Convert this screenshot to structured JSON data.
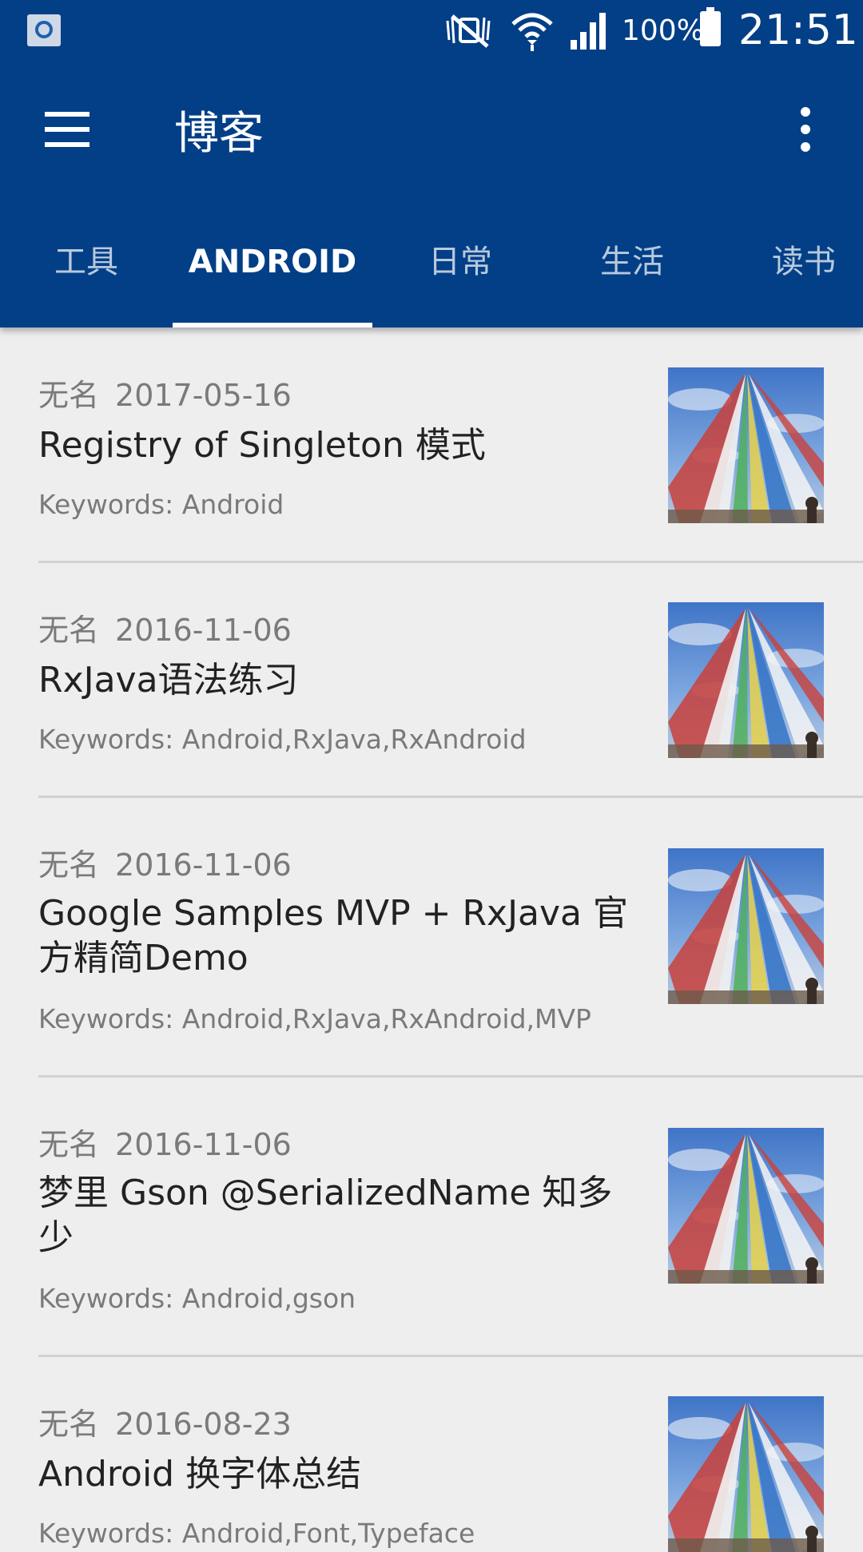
{
  "status_bar": {
    "battery_percent": "100%",
    "time": "21:51",
    "icons": [
      "notification-search-icon",
      "mute-icon",
      "wifi-icon",
      "signal-icon",
      "battery-icon"
    ]
  },
  "toolbar": {
    "title": "博客",
    "menu_icon": "hamburger-menu-icon",
    "overflow_icon": "more-vert-icon"
  },
  "tabs": [
    {
      "label": "工具",
      "active": false
    },
    {
      "label": "ANDROID",
      "active": true
    },
    {
      "label": "日常",
      "active": false
    },
    {
      "label": "生活",
      "active": false
    },
    {
      "label": "读书",
      "active": false
    }
  ],
  "articles": [
    {
      "author": "无名",
      "date": "2017-05-16",
      "title": "Registry of Singleton 模式",
      "keywords": "Keywords: Android"
    },
    {
      "author": "无名",
      "date": "2016-11-06",
      "title": "RxJava语法练习",
      "keywords": "Keywords: Android,RxJava,RxAndroid"
    },
    {
      "author": "无名",
      "date": "2016-11-06",
      "title": "Google Samples MVP + RxJava 官方精简Demo",
      "keywords": "Keywords: Android,RxJava,RxAndroid,MVP"
    },
    {
      "author": "无名",
      "date": "2016-11-06",
      "title": "梦里 Gson @SerializedName 知多少",
      "keywords": "Keywords: Android,gson"
    },
    {
      "author": "无名",
      "date": "2016-08-23",
      "title": "Android 换字体总结",
      "keywords": "Keywords: Android,Font,Typeface"
    }
  ],
  "colors": {
    "primary": "#033f87",
    "background": "#eeeeee"
  }
}
